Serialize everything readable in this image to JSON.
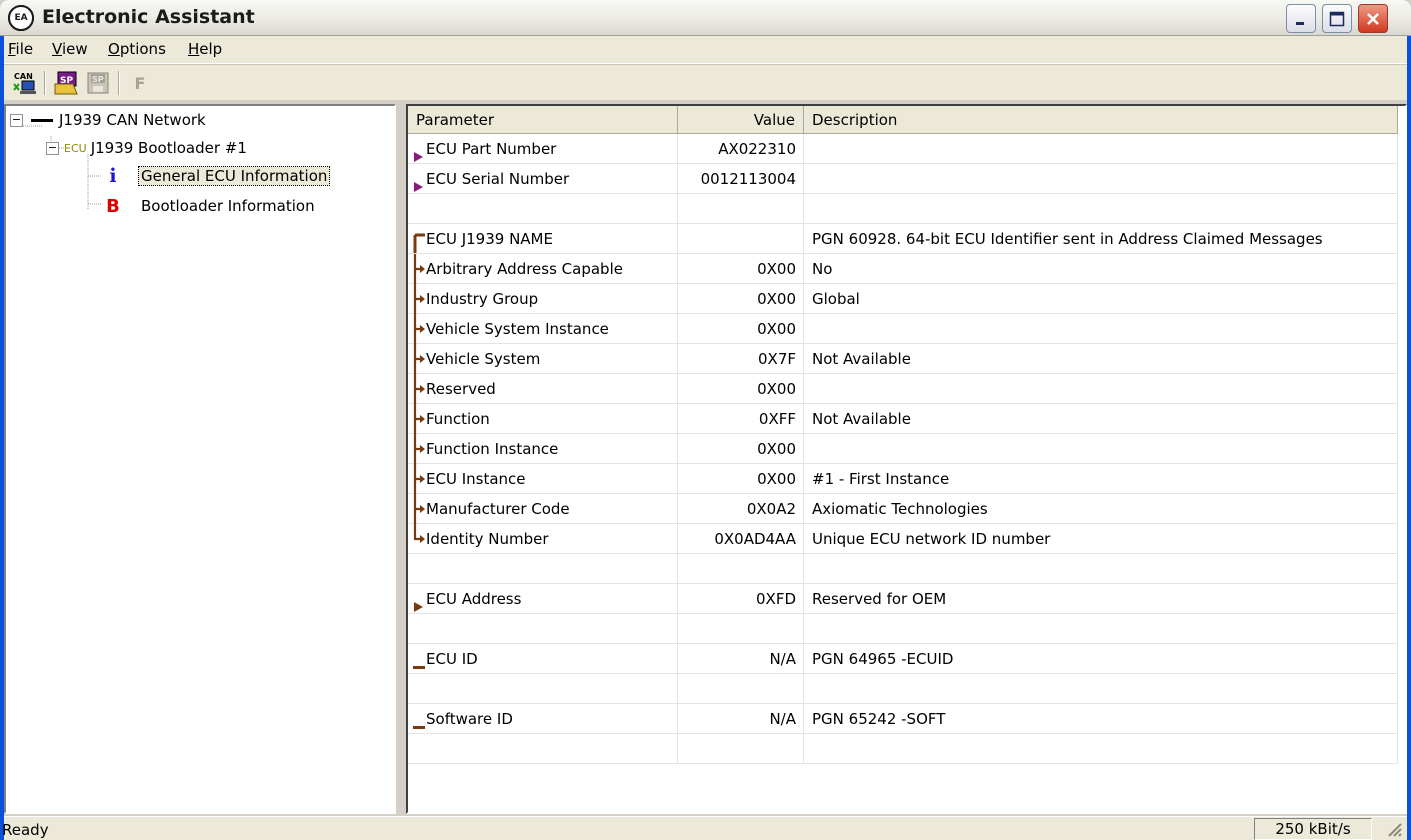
{
  "window": {
    "title": "Electronic Assistant",
    "app_icon": "EA-logo-icon"
  },
  "menu": [
    "File",
    "View",
    "Options",
    "Help"
  ],
  "toolbar": {
    "items": [
      "can-network-icon",
      "sp-open-icon",
      "sp-save-icon",
      "flash-icon"
    ],
    "can_label": "CAN",
    "sp_label": "SP",
    "flash_label": "F"
  },
  "tree": {
    "items": [
      {
        "label": "J1939 CAN Network",
        "icon": "can-bus-icon"
      },
      {
        "label": "J1939 Bootloader #1",
        "icon": "ecu-icon",
        "icon_text": "ECU"
      },
      {
        "label": "General ECU Information",
        "icon": "info-icon",
        "icon_text": "i",
        "selected": true
      },
      {
        "label": "Bootloader Information",
        "icon": "bootloader-icon",
        "icon_text": "B"
      }
    ]
  },
  "grid": {
    "headers": [
      "Parameter",
      "Value",
      "Description"
    ],
    "rows": [
      {
        "param": "ECU Part Number",
        "value": "AX022310",
        "desc": "",
        "marker": "purple-arrow"
      },
      {
        "param": "ECU Serial Number",
        "value": "0012113004",
        "desc": "",
        "marker": "purple-arrow"
      },
      {
        "param": "",
        "value": "",
        "desc": "",
        "marker": ""
      },
      {
        "param": "ECU J1939 NAME",
        "value": "",
        "desc": "PGN 60928. 64-bit ECU Identifier sent in Address Claimed Messages",
        "marker": "tree-root"
      },
      {
        "param": "Arbitrary Address Capable",
        "value": "0X00",
        "desc": "No",
        "marker": "tree-branch"
      },
      {
        "param": "Industry Group",
        "value": "0X00",
        "desc": "Global",
        "marker": "tree-branch"
      },
      {
        "param": "Vehicle System Instance",
        "value": "0X00",
        "desc": "",
        "marker": "tree-branch"
      },
      {
        "param": "Vehicle System",
        "value": "0X7F",
        "desc": "Not Available",
        "marker": "tree-branch"
      },
      {
        "param": "Reserved",
        "value": "0X00",
        "desc": "",
        "marker": "tree-branch"
      },
      {
        "param": "Function",
        "value": "0XFF",
        "desc": "Not Available",
        "marker": "tree-branch"
      },
      {
        "param": "Function Instance",
        "value": "0X00",
        "desc": "",
        "marker": "tree-branch"
      },
      {
        "param": "ECU Instance",
        "value": "0X00",
        "desc": "#1 - First Instance",
        "marker": "tree-branch"
      },
      {
        "param": "Manufacturer Code",
        "value": "0X0A2",
        "desc": "Axiomatic Technologies",
        "marker": "tree-branch"
      },
      {
        "param": "Identity Number",
        "value": "0X0AD4AA",
        "desc": "Unique ECU network ID number",
        "marker": "tree-last"
      },
      {
        "param": "",
        "value": "",
        "desc": "",
        "marker": ""
      },
      {
        "param": "ECU Address",
        "value": "0XFD",
        "desc": "Reserved for OEM",
        "marker": "brown-arrow"
      },
      {
        "param": "",
        "value": "",
        "desc": "",
        "marker": ""
      },
      {
        "param": "ECU ID",
        "value": "N/A",
        "desc": "PGN 64965   -ECUID",
        "marker": "dash"
      },
      {
        "param": "",
        "value": "",
        "desc": "",
        "marker": ""
      },
      {
        "param": "Software ID",
        "value": "N/A",
        "desc": "PGN 65242   -SOFT",
        "marker": "dash"
      },
      {
        "param": "",
        "value": "",
        "desc": "",
        "marker": ""
      }
    ]
  },
  "statusbar": {
    "text": "Ready",
    "baud": "250 kBit/s"
  },
  "colors": {
    "purple_marker": "#8b1a7a",
    "brown_marker": "#7a3a10",
    "info_blue": "#1a1ad0",
    "bootloader_red": "#e00000",
    "ecu_olive": "#8a8a00"
  }
}
